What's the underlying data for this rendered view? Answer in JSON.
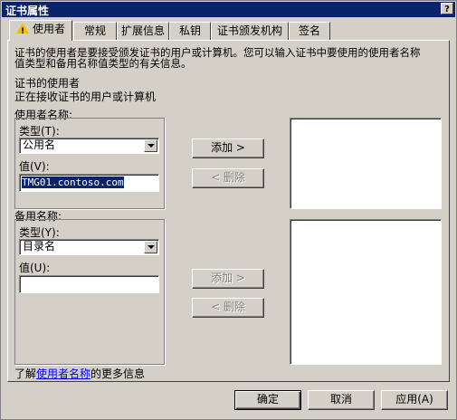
{
  "window": {
    "title": "证书属性",
    "help_label": "?"
  },
  "tabs": [
    {
      "label": "使用者"
    },
    {
      "label": "常规"
    },
    {
      "label": "扩展信息"
    },
    {
      "label": "私钥"
    },
    {
      "label": "证书颁发机构"
    },
    {
      "label": "签名"
    }
  ],
  "intro": {
    "line1": "证书的使用者是要接受颁发证书的用户或计算机。您可以输入证书中要使用的使用者名称",
    "line2": "值类型和备用名称值类型的有关信息。"
  },
  "subject": {
    "heading": "证书的使用者",
    "desc": "正在接收证书的用户或计算机"
  },
  "subject_name": {
    "group_label": "使用者名称:",
    "type_label": "类型(T):",
    "type_value": "公用名",
    "value_label": "值(V):",
    "value": "TMG01.contoso.com",
    "add_label": "添加 >",
    "remove_label": "< 删除"
  },
  "alt_name": {
    "group_label": "备用名称:",
    "type_label": "类型(Y):",
    "type_value": "目录名",
    "value_label": "值(U):",
    "value": "",
    "add_label": "添加 >",
    "remove_label": "< 删除"
  },
  "footer": {
    "prefix": "了解",
    "link": "使用者名称",
    "suffix": "的更多信息"
  },
  "buttons": {
    "ok": "确定",
    "cancel": "取消",
    "apply": "应用(A)"
  }
}
